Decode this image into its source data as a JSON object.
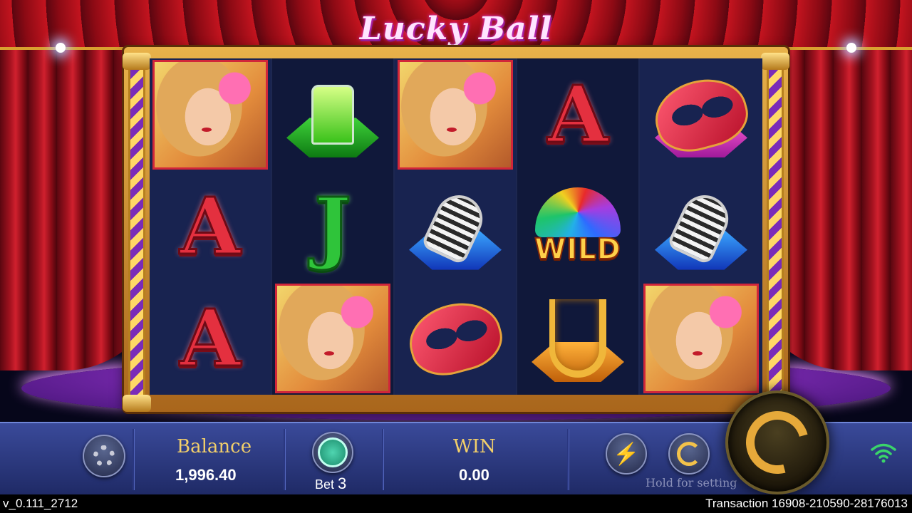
{
  "game": {
    "title": "Lucky Ball"
  },
  "reels": [
    [
      "lady",
      "letter-a",
      "letter-a"
    ],
    [
      "champagne",
      "letter-j",
      "lady"
    ],
    [
      "lady",
      "microphone",
      "mask"
    ],
    [
      "letter-a",
      "wild",
      "saxophone"
    ],
    [
      "mask",
      "microphone",
      "lady"
    ]
  ],
  "symbols": {
    "letter_a": "A",
    "letter_j": "J",
    "wild": "WILD"
  },
  "controls": {
    "settings_icon": "gear-icon",
    "balance_label": "Balance",
    "balance_value": "1,996.40",
    "bet_label": "Bet",
    "bet_value": "3",
    "win_label": "WIN",
    "win_value": "0.00",
    "turbo_icon": "lightning-icon",
    "auto_icon": "autospin-icon",
    "hold_label": "Hold for setting",
    "spin_icon": "spin-arrow-icon",
    "signal_icon": "wifi-icon"
  },
  "footer": {
    "version": "v_0.111_2712",
    "transaction": "Transaction 16908-210590-28176013"
  },
  "colors": {
    "gold": "#f2cf6a",
    "bar": "#1f2a66",
    "wifi": "#3ad46a"
  }
}
